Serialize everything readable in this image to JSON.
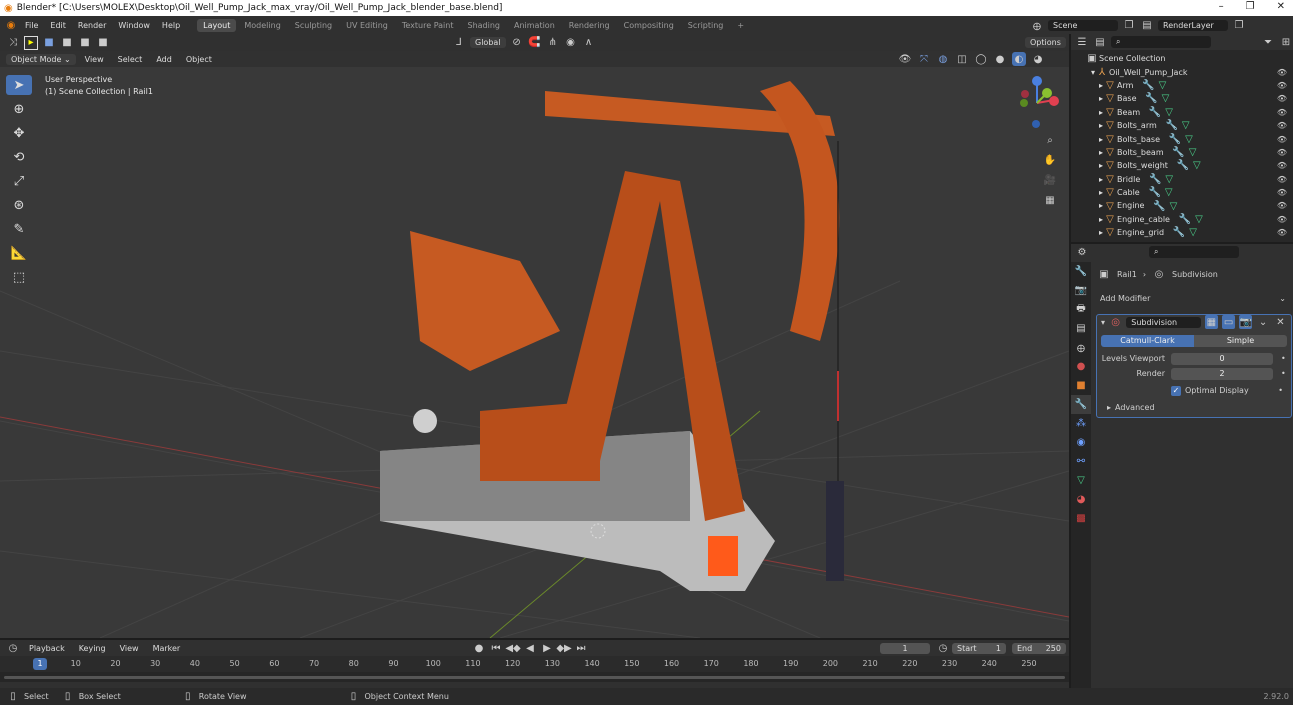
{
  "titlebar": {
    "title": "Blender* [C:\\Users\\MOLEX\\Desktop\\Oil_Well_Pump_Jack_max_vray/Oil_Well_Pump_Jack_blender_base.blend]",
    "minimize": "–",
    "restore": "❐",
    "close": "✕"
  },
  "menu": [
    "File",
    "Edit",
    "Render",
    "Window",
    "Help"
  ],
  "workspaces": [
    "Layout",
    "Modeling",
    "Sculpting",
    "UV Editing",
    "Texture Paint",
    "Shading",
    "Animation",
    "Rendering",
    "Compositing",
    "Scripting"
  ],
  "scene": {
    "name": "Scene",
    "view_layer": "RenderLayer"
  },
  "viewport_header": {
    "mode": "Object Mode",
    "menus": [
      "View",
      "Select",
      "Add",
      "Object"
    ],
    "orientation": "Global",
    "options": "Options"
  },
  "viewport_overlay": {
    "line1": "User Perspective",
    "line2": "(1) Scene Collection | Rail1"
  },
  "outliner": {
    "scene_collection": "Scene Collection",
    "collection": "Oil_Well_Pump_Jack",
    "objects": [
      "Arm",
      "Base",
      "Beam",
      "Bolts_arm",
      "Bolts_base",
      "Bolts_beam",
      "Bolts_weight",
      "Bridle",
      "Cable",
      "Engine",
      "Engine_cable",
      "Engine_grid"
    ]
  },
  "properties": {
    "object": "Rail1",
    "modifier_context": "Subdivision",
    "add_modifier": "Add Modifier",
    "modifier_name": "Subdivision",
    "tab_catmull": "Catmull-Clark",
    "tab_simple": "Simple",
    "levels_viewport_label": "Levels Viewport",
    "levels_viewport_value": "0",
    "render_label": "Render",
    "render_value": "2",
    "optimal_display": "Optimal Display",
    "advanced": "Advanced"
  },
  "timeline": {
    "menus": [
      "Playback",
      "Keying",
      "View",
      "Marker"
    ],
    "current_frame": "1",
    "start_label": "Start",
    "start": "1",
    "end_label": "End",
    "end": "250",
    "ticks": [
      "10",
      "20",
      "30",
      "40",
      "50",
      "60",
      "70",
      "80",
      "90",
      "100",
      "110",
      "120",
      "130",
      "140",
      "150",
      "160",
      "170",
      "180",
      "190",
      "200",
      "210",
      "220",
      "230",
      "240",
      "250"
    ],
    "playhead": "1"
  },
  "statusbar": {
    "select": "Select",
    "box_select": "Box Select",
    "rotate_view": "Rotate View",
    "context_menu": "Object Context Menu",
    "version": "2.92.0"
  },
  "colors": {
    "accent": "#4772b3",
    "rust": "#c2521c",
    "header": "#303030",
    "viewport": "#393939"
  }
}
